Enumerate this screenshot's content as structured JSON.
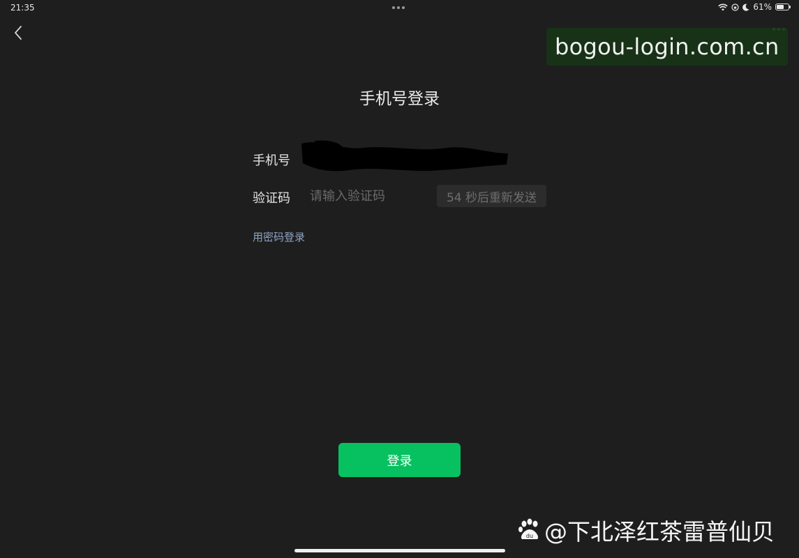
{
  "status_bar": {
    "time": "21:35",
    "battery_percent": "61%",
    "battery_level": 0.61
  },
  "nav": {
    "back_icon": "chevron-left-icon",
    "more_icon": "more-dots-icon"
  },
  "watermark_url": "bogou-login.com.cn",
  "page": {
    "title": "手机号登录"
  },
  "form": {
    "phone_label": "手机号",
    "phone_value_redacted": true,
    "code_label": "验证码",
    "code_placeholder": "请输入验证码",
    "code_value": "",
    "resend_label": "54 秒后重新发送"
  },
  "links": {
    "password_login": "用密码登录"
  },
  "actions": {
    "login_label": "登录"
  },
  "watermark_author": "@下北泽红茶雷普仙贝",
  "colors": {
    "background": "#1e1e1e",
    "accent": "#07c160",
    "link": "#8fa4c4"
  }
}
